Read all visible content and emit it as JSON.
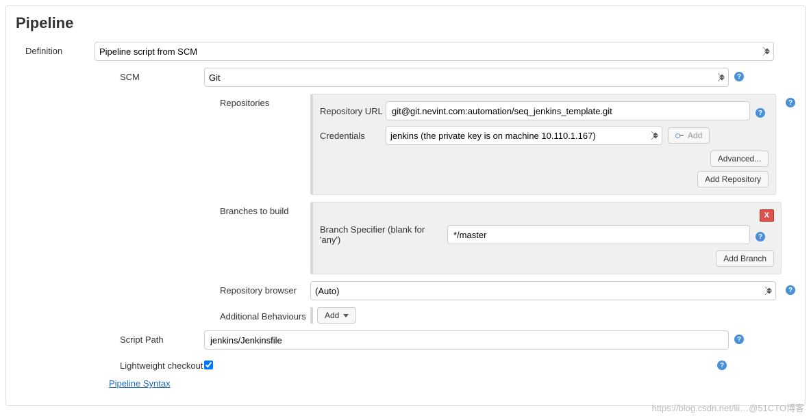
{
  "section": {
    "title": "Pipeline"
  },
  "definition": {
    "label": "Definition",
    "value": "Pipeline script from SCM"
  },
  "scm": {
    "label": "SCM",
    "value": "Git"
  },
  "repositories": {
    "label": "Repositories",
    "repo_url_label": "Repository URL",
    "repo_url_value": "git@git.nevint.com:automation/seq_jenkins_template.git",
    "credentials_label": "Credentials",
    "credentials_value": "jenkins (the private key is on machine 10.110.1.167)",
    "add_cred_label": "Add",
    "advanced_label": "Advanced...",
    "add_repo_label": "Add Repository"
  },
  "branches": {
    "label": "Branches to build",
    "specifier_label": "Branch Specifier (blank for 'any')",
    "specifier_value": "*/master",
    "delete_label": "X",
    "add_branch_label": "Add Branch"
  },
  "repo_browser": {
    "label": "Repository browser",
    "value": "(Auto)"
  },
  "additional_behaviours": {
    "label": "Additional Behaviours",
    "add_label": "Add"
  },
  "script_path": {
    "label": "Script Path",
    "value": "jenkins/Jenkinsfile"
  },
  "lightweight": {
    "label": "Lightweight checkout",
    "checked": true
  },
  "pipeline_syntax": {
    "label": "Pipeline Syntax"
  },
  "help_char": "?",
  "watermark": "https://blog.csdn.net/lii…@51CTO博客"
}
